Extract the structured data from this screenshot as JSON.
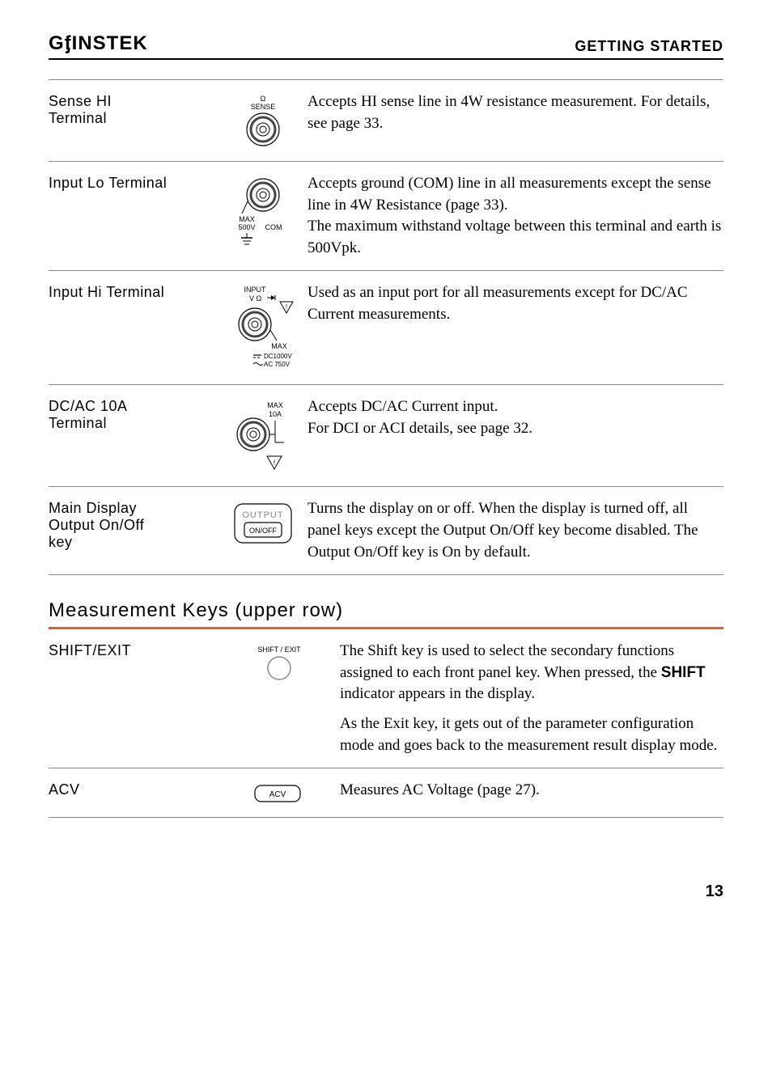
{
  "header": {
    "logo": "GᶂINSTEK",
    "title": "GETTING STARTED"
  },
  "rows": [
    {
      "label": "Sense HI\nTerminal",
      "desc": "Accepts HI sense line in 4W resistance measurement. For details, see page 33."
    },
    {
      "label": "Input Lo Terminal",
      "desc": "Accepts ground (COM) line in all measurements except the sense line in 4W Resistance (page 33).\nThe maximum withstand voltage between this terminal and earth is 500Vpk."
    },
    {
      "label": "Input Hi Terminal",
      "desc": "Used as an input port for all measurements except for DC/AC Current measurements."
    },
    {
      "label": "DC/AC 10A\nTerminal",
      "desc": "Accepts DC/AC Current input.\nFor DCI or ACI details, see page 32."
    },
    {
      "label": "Main Display\nOutput On/Off\nkey",
      "desc": "Turns the display on or off. When the display is turned off, all panel keys except the Output On/Off key become disabled. The Output On/Off key is On by default."
    }
  ],
  "section2": {
    "title": "Measurement Keys (upper row)",
    "rows": [
      {
        "label": "SHIFT/EXIT",
        "button_label": "SHIFT / EXIT",
        "desc1_pre": "The Shift key is used to select the secondary functions assigned to each front panel key. When pressed, the ",
        "desc1_bold": "SHIFT",
        "desc1_post": " indicator appears in the display.",
        "desc2": "As the Exit key, it gets out of the parameter configuration mode and goes back to the measurement result display mode."
      },
      {
        "label": "ACV",
        "button_label": "ACV",
        "desc": "Measures AC Voltage (page 27)."
      }
    ]
  },
  "icons": {
    "sense_top": "Ω",
    "sense_label": "SENSE",
    "com_max": "MAX",
    "com_500v": "500V",
    "com_label": "COM",
    "input_label": "INPUT",
    "input_vohm": "V Ω",
    "input_max": "MAX",
    "input_dc": "DC1000V",
    "input_ac": "AC 750V",
    "dcac_max": "MAX",
    "dcac_10a": "10A",
    "output_label": "OUTPUT",
    "onoff_label": "ON/OFF"
  },
  "page_number": "13"
}
